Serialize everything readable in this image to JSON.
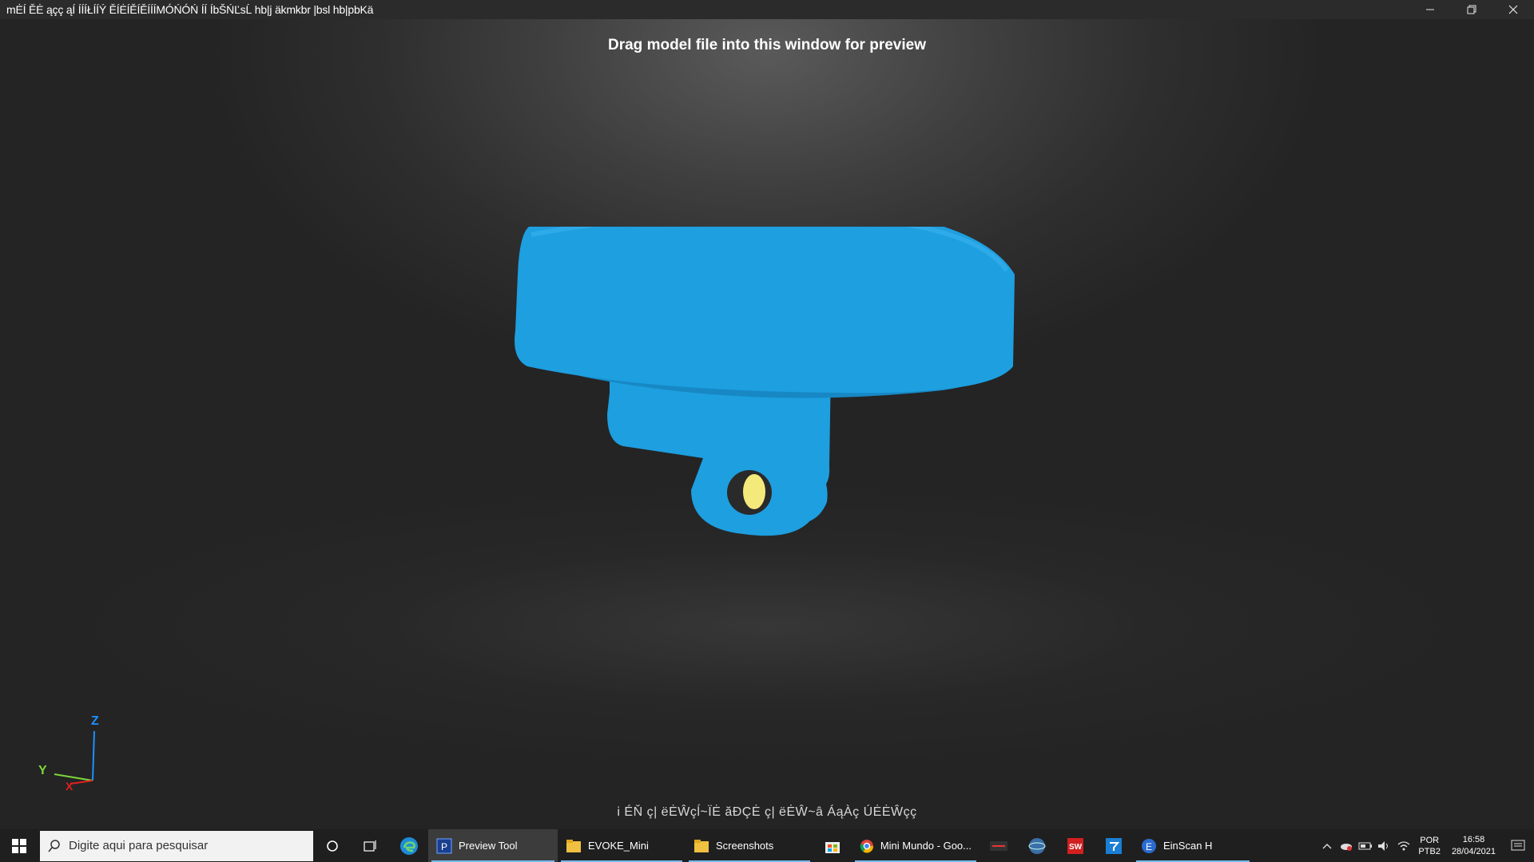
{
  "window": {
    "title": "mĖÍ ĚĖ ąçç ąÍ ÍÍÍŁÍÍÝ ĚÍĖÍĚÍĚÍÍÍMÓŃÓŃ ÍÍ ÍbŠŃĽsĹ hb|j äkmkbr |bsl hb|pbKä",
    "minimize_icon": "minimize-icon",
    "restore_icon": "restore-icon",
    "close_icon": "close-icon"
  },
  "viewport": {
    "hint": "Drag model file into this window for preview",
    "status_text": "i ÉŇ ç| ëĖŴçĺ~ÏĖ ăĐÇĖ ç| ëĖŴ~â ÁąÀç ÚĖĖŴçç",
    "model_color": "#1d9fe0",
    "hole_color": "#f4ea7c",
    "axis": {
      "z_label": "Z",
      "y_label": "Y",
      "x_label": "X",
      "z_color": "#1e90ff",
      "y_color": "#7cd63a",
      "x_color": "#e02020"
    }
  },
  "taskbar": {
    "start_icon": "windows-start-icon",
    "search_placeholder": "Digite aqui para pesquisar",
    "tasks": [
      {
        "label": "Preview Tool",
        "icon": "preview-tool-icon",
        "active": true
      },
      {
        "label": "EVOKE_Mini",
        "icon": "folder-icon",
        "active": false
      },
      {
        "label": "Screenshots",
        "icon": "folder-icon",
        "active": false
      },
      {
        "label": "Mini Mundo - Goo...",
        "icon": "chrome-icon",
        "active": false
      },
      {
        "label": "EinScan H",
        "icon": "einscan-icon",
        "active": false
      }
    ],
    "language": {
      "line1": "POR",
      "line2": "PTB2"
    },
    "clock": {
      "time": "16:58",
      "date": "28/04/2021"
    },
    "colors": {
      "accent_underline": "#76b9ed",
      "background": "#1f1f1f"
    }
  }
}
